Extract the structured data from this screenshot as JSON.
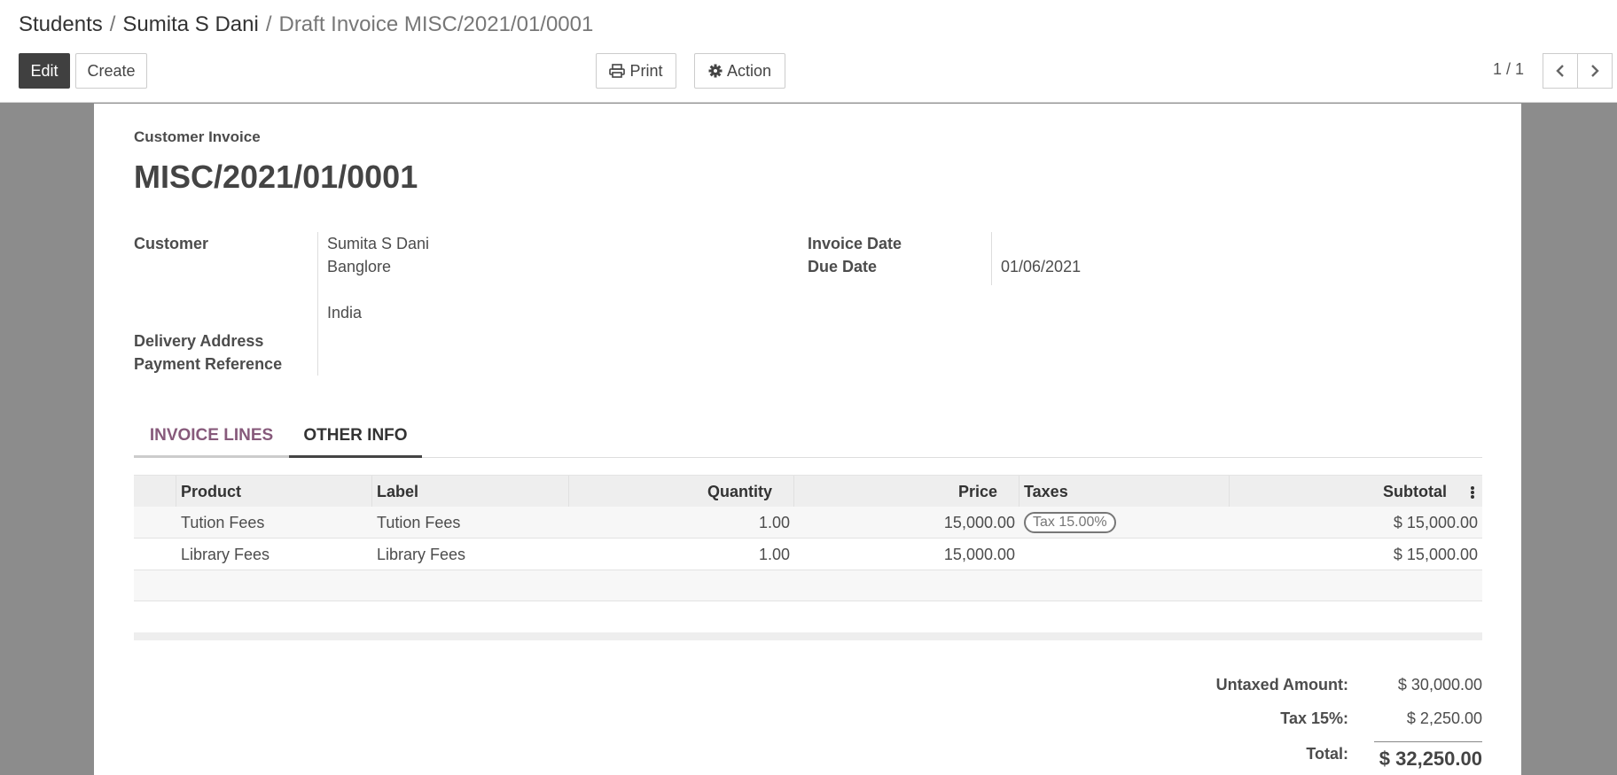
{
  "breadcrumb": {
    "items": [
      "Students",
      "Sumita S Dani"
    ],
    "separator": "/",
    "current": "Draft Invoice MISC/2021/01/0001"
  },
  "toolbar": {
    "edit_label": "Edit",
    "create_label": "Create",
    "print_label": "Print",
    "action_label": "Action"
  },
  "pager": {
    "value": "1 / 1"
  },
  "invoice": {
    "type_label": "Customer Invoice",
    "number": "MISC/2021/01/0001",
    "fields": {
      "customer_label": "Customer",
      "customer_name": "Sumita S Dani",
      "customer_city": "Banglore",
      "customer_country": "India",
      "delivery_address_label": "Delivery Address",
      "payment_reference_label": "Payment Reference",
      "invoice_date_label": "Invoice Date",
      "due_date_label": "Due Date",
      "due_date_value": "01/06/2021"
    }
  },
  "tabs": [
    {
      "label": "Invoice Lines",
      "active": true
    },
    {
      "label": "Other Info",
      "active": false
    }
  ],
  "table": {
    "headers": {
      "product": "Product",
      "label": "Label",
      "quantity": "Quantity",
      "price": "Price",
      "taxes": "Taxes",
      "subtotal": "Subtotal"
    },
    "rows": [
      {
        "product": "Tution Fees",
        "label": "Tution Fees",
        "quantity": "1.00",
        "price": "15,000.00",
        "tax": "Tax 15.00%",
        "subtotal": "$ 15,000.00"
      },
      {
        "product": "Library Fees",
        "label": "Library Fees",
        "quantity": "1.00",
        "price": "15,000.00",
        "tax": "",
        "subtotal": "$ 15,000.00"
      }
    ]
  },
  "totals": {
    "untaxed_label": "Untaxed Amount:",
    "untaxed_value": "$ 30,000.00",
    "tax_label": "Tax 15%:",
    "tax_value": "$ 2,250.00",
    "total_label": "Total:",
    "total_value": "$ 32,250.00"
  },
  "colors": {
    "accent": "#875a7b",
    "edit_button": "#404040",
    "background": "#8c8c8c"
  },
  "icons": [
    "print-icon",
    "gear-icon",
    "chevron-left-icon",
    "chevron-right-icon",
    "kebab-menu-icon"
  ]
}
